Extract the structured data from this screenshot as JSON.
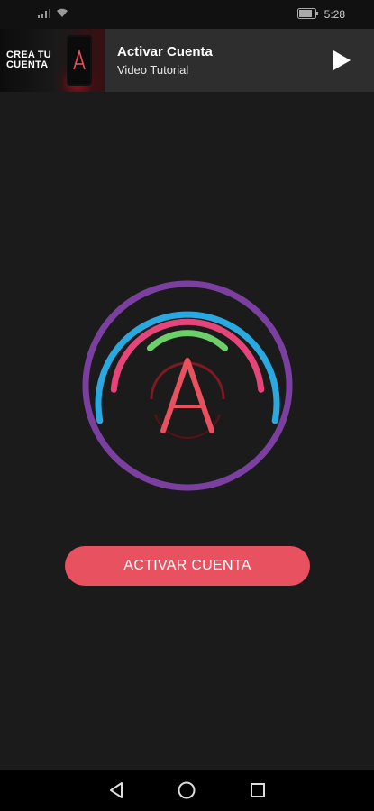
{
  "status_bar": {
    "time": "5:28",
    "battery_label": "80"
  },
  "banner": {
    "thumbnail_text_line1": "CREA TU",
    "thumbnail_text_line2": "CUENTA",
    "title": "Activar Cuenta",
    "subtitle": "Video Tutorial"
  },
  "main": {
    "activate_button_label": "ACTIVAR CUENTA"
  },
  "colors": {
    "background": "#1b1b1b",
    "button": "#e8515f",
    "ring_purple": "#7b3fa0",
    "ring_blue": "#2aa9e0",
    "ring_pink": "#e6457a",
    "ring_green": "#6ccf6a",
    "logo_red": "#e8515f"
  }
}
